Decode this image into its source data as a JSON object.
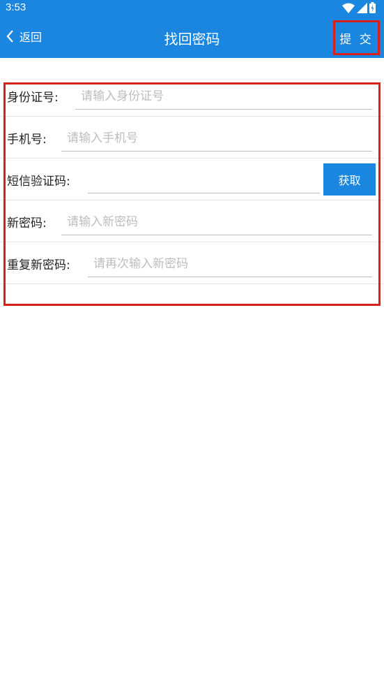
{
  "status_bar": {
    "time": "3:53"
  },
  "header": {
    "back_label": "返回",
    "title": "找回密码",
    "submit_label": "提 交"
  },
  "form": {
    "id_card": {
      "label": "身份证号:",
      "placeholder": "请输入身份证号"
    },
    "phone": {
      "label": "手机号:",
      "placeholder": "请输入手机号"
    },
    "sms_code": {
      "label": "短信验证码:",
      "placeholder": "",
      "button_label": "获取"
    },
    "new_password": {
      "label": "新密码:",
      "placeholder": "请输入新密码"
    },
    "repeat_password": {
      "label": "重复新密码:",
      "placeholder": "请再次输入新密码"
    }
  },
  "colors": {
    "primary": "#1a86df",
    "highlight": "#d9211b",
    "placeholder": "#bdbdbd"
  }
}
